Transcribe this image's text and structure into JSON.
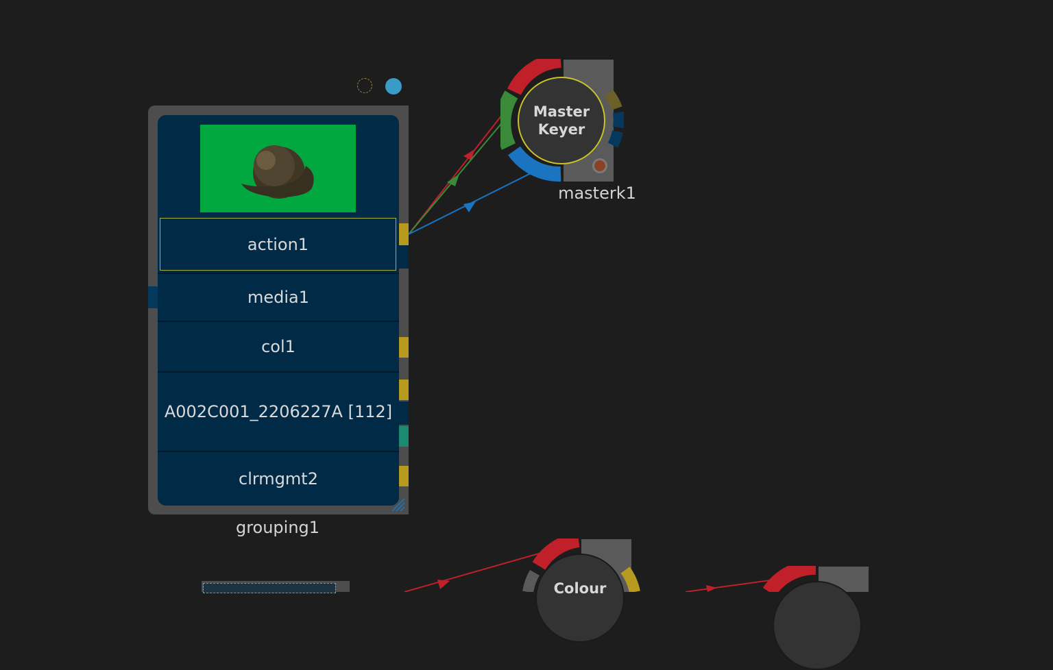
{
  "group": {
    "name": "grouping1",
    "rows": [
      {
        "label": "action1"
      },
      {
        "label": "media1"
      },
      {
        "label": "col1"
      },
      {
        "label": "A002C001_2206227A [112]"
      },
      {
        "label": "clrmgmt2"
      }
    ]
  },
  "masterkeyer": {
    "title_line1": "Master",
    "title_line2": "Keyer",
    "name": "masterk1"
  },
  "colour_node": {
    "title": "Colour"
  },
  "colors": {
    "background": "#1d1d1d",
    "group_fill": "#002a45",
    "red_link": "#c0202a",
    "green_link": "#3a8a3a",
    "blue_link": "#1a74c0",
    "port_yellow": "#b89a21",
    "port_teal": "#1a8a70"
  }
}
